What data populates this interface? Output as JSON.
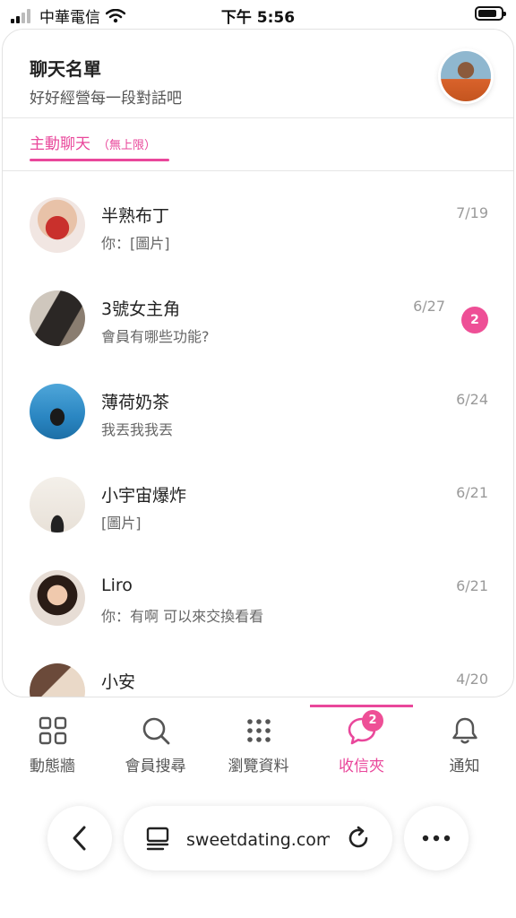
{
  "status_bar": {
    "carrier": "中華電信",
    "time": "下午 5:56"
  },
  "header": {
    "title": "聊天名單",
    "subtitle": "好好經營每一段對話吧"
  },
  "tab": {
    "label": "主動聊天",
    "note": "（無上限）"
  },
  "chats": [
    {
      "name": "半熟布丁",
      "last": "你：[圖片]",
      "date": "7/19"
    },
    {
      "name": "3號女主角",
      "last": "會員有哪些功能?",
      "date": "6/27",
      "unread": "2"
    },
    {
      "name": "薄荷奶茶",
      "last": "我丟我我丟",
      "date": "6/24"
    },
    {
      "name": "小宇宙爆炸",
      "last": "[圖片]",
      "date": "6/21"
    },
    {
      "name": "Liro",
      "last": "你：有啊 可以來交換看看",
      "date": "6/21"
    },
    {
      "name": "小安",
      "last": "",
      "date": "4/20"
    }
  ],
  "nav": [
    {
      "label": "動態牆",
      "icon": "grid-icon"
    },
    {
      "label": "會員搜尋",
      "icon": "search-icon"
    },
    {
      "label": "瀏覽資料",
      "icon": "dots-grid-icon"
    },
    {
      "label": "收信夾",
      "icon": "chat-bubble-icon",
      "badge": "2",
      "active": true
    },
    {
      "label": "通知",
      "icon": "bell-icon"
    }
  ],
  "browser": {
    "url": "sweetdating.com"
  },
  "colors": {
    "accent": "#e9479b",
    "badge": "#ee4f96"
  }
}
